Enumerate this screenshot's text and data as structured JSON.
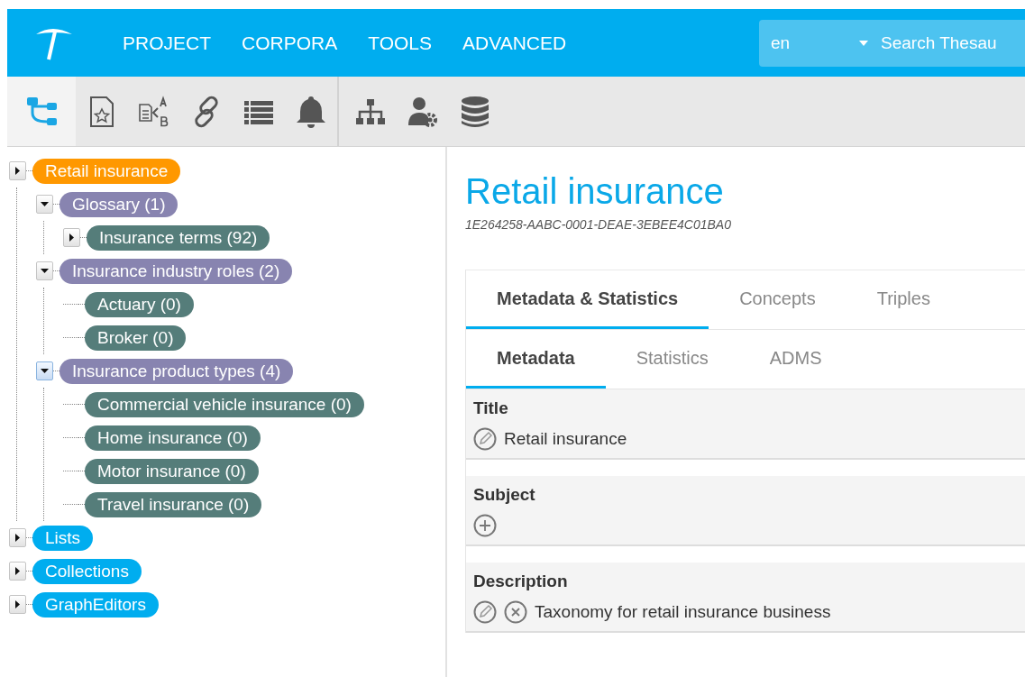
{
  "header": {
    "nav": [
      {
        "label": "PROJECT"
      },
      {
        "label": "CORPORA"
      },
      {
        "label": "TOOLS"
      },
      {
        "label": "ADVANCED"
      }
    ],
    "language": "en",
    "search": {
      "placeholder": "Search Thesau"
    }
  },
  "toolbar": {
    "groups": [
      [
        {
          "kind": "tree",
          "selected": true
        },
        {
          "kind": "doc-star",
          "selected": false
        },
        {
          "kind": "doc-ab",
          "selected": false
        },
        {
          "kind": "link",
          "selected": false
        },
        {
          "kind": "list",
          "selected": false
        },
        {
          "kind": "bell",
          "selected": false
        }
      ],
      [
        {
          "kind": "hierarchy",
          "selected": false
        },
        {
          "kind": "user-gear",
          "selected": false
        },
        {
          "kind": "database",
          "selected": false
        }
      ]
    ]
  },
  "tree": [
    {
      "label": "Retail insurance",
      "color": "#ff9800",
      "expanded": false,
      "focused": false,
      "children": [
        {
          "label": "Glossary (1)",
          "color": "#8884b0",
          "expanded": true,
          "focused": false,
          "children": [
            {
              "label": "Insurance terms (92)",
              "color": "#557d7a",
              "expanded": false,
              "focused": false
            }
          ]
        },
        {
          "label": "Insurance industry roles (2)",
          "color": "#8884b0",
          "expanded": true,
          "focused": false,
          "children": [
            {
              "label": "Actuary (0)",
              "color": "#557d7a"
            },
            {
              "label": "Broker (0)",
              "color": "#557d7a"
            }
          ]
        },
        {
          "label": "Insurance product types (4)",
          "color": "#8884b0",
          "expanded": true,
          "focused": true,
          "children": [
            {
              "label": "Commercial vehicle insurance (0)",
              "color": "#557d7a"
            },
            {
              "label": "Home insurance (0)",
              "color": "#557d7a"
            },
            {
              "label": "Motor insurance (0)",
              "color": "#557d7a"
            },
            {
              "label": "Travel insurance (0)",
              "color": "#557d7a"
            }
          ]
        }
      ]
    },
    {
      "label": "Lists",
      "color": "#00adef",
      "expanded": false,
      "focused": false
    },
    {
      "label": "Collections",
      "color": "#00adef",
      "expanded": false,
      "focused": false
    },
    {
      "label": "GraphEditors",
      "color": "#00adef",
      "expanded": false,
      "focused": false
    }
  ],
  "detail": {
    "title": "Retail insurance",
    "id": "1E264258-AABC-0001-DEAE-3EBEE4C01BA0",
    "tabs": [
      {
        "label": "Metadata & Statistics",
        "selected": true
      },
      {
        "label": "Concepts",
        "selected": false
      },
      {
        "label": "Triples",
        "selected": false
      }
    ],
    "subtabs": [
      {
        "label": "Metadata",
        "selected": true
      },
      {
        "label": "Statistics",
        "selected": false
      },
      {
        "label": "ADMS",
        "selected": false
      }
    ],
    "fields": [
      {
        "label": "Title",
        "actions": [
          {
            "kind": "edit"
          }
        ],
        "value": "Retail insurance"
      },
      {
        "label": "Subject",
        "actions": [
          {
            "kind": "add"
          }
        ]
      },
      {
        "label": "Description",
        "actions": [
          {
            "kind": "edit"
          },
          {
            "kind": "remove"
          }
        ],
        "value": "Taxonomy for retail insurance business"
      }
    ]
  }
}
